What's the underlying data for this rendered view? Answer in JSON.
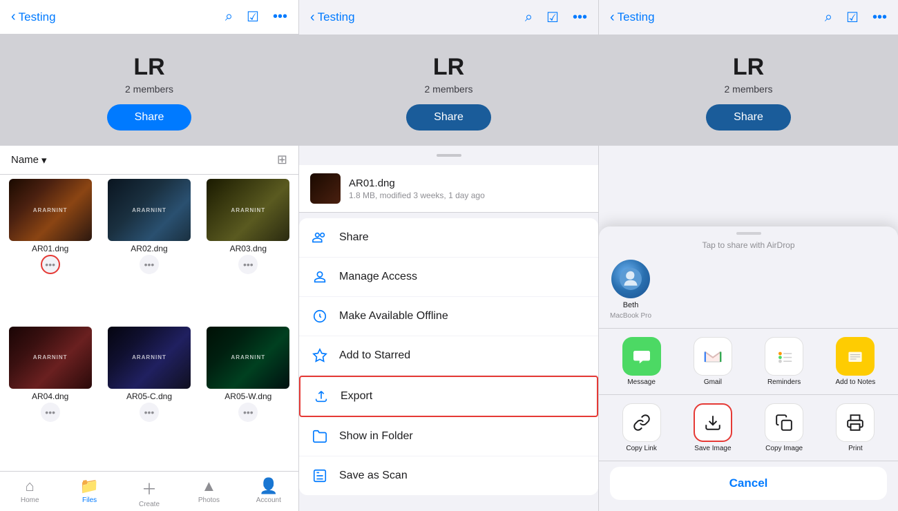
{
  "panel1": {
    "nav": {
      "back_label": "Testing",
      "search_icon": "search",
      "check_icon": "check",
      "more_icon": "more"
    },
    "header": {
      "title": "LR",
      "members": "2 members",
      "share_btn": "Share"
    },
    "sort": {
      "label": "Name",
      "chevron": "▾"
    },
    "files": [
      {
        "name": "AR01.dng",
        "thumb": "thumb-1",
        "show_more": true,
        "highlighted": true
      },
      {
        "name": "AR02.dng",
        "thumb": "thumb-2",
        "show_more": true,
        "highlighted": false
      },
      {
        "name": "AR03.dng",
        "thumb": "thumb-3",
        "show_more": true,
        "highlighted": false
      },
      {
        "name": "AR04.dng",
        "thumb": "thumb-4",
        "show_more": true,
        "highlighted": false
      },
      {
        "name": "AR05-C.dng",
        "thumb": "thumb-5",
        "show_more": true,
        "highlighted": false
      },
      {
        "name": "AR05-W.dng",
        "thumb": "thumb-6",
        "show_more": true,
        "highlighted": false
      }
    ],
    "tabs": [
      {
        "icon": "🏠",
        "label": "Home",
        "active": false
      },
      {
        "icon": "📁",
        "label": "Files",
        "active": true
      },
      {
        "icon": "➕",
        "label": "Create",
        "active": false
      },
      {
        "icon": "🖼️",
        "label": "Photos",
        "active": false
      },
      {
        "icon": "👤",
        "label": "Account",
        "active": false
      }
    ]
  },
  "panel2": {
    "nav": {
      "back_label": "Testing"
    },
    "header": {
      "title": "LR",
      "members": "2 members",
      "share_btn": "Share"
    },
    "file_info": {
      "name": "AR01.dng",
      "meta": "1.8 MB, modified 3 weeks, 1 day ago"
    },
    "menu_items": [
      {
        "icon": "👥",
        "label": "Share",
        "highlighted": false
      },
      {
        "icon": "👤",
        "label": "Manage Access",
        "highlighted": false
      },
      {
        "icon": "⬇️",
        "label": "Make Available Offline",
        "highlighted": false
      },
      {
        "icon": "⭐",
        "label": "Add to Starred",
        "highlighted": false
      },
      {
        "icon": "📤",
        "label": "Export",
        "highlighted": true
      },
      {
        "icon": "📂",
        "label": "Show in Folder",
        "highlighted": false
      },
      {
        "icon": "📄",
        "label": "Save as Scan",
        "highlighted": false
      }
    ]
  },
  "panel3": {
    "nav": {
      "back_label": "Testing"
    },
    "header": {
      "title": "LR",
      "members": "2 members",
      "share_btn": "Share"
    },
    "share_sheet": {
      "airdrop_label": "Tap to share with AirDrop",
      "airdrop_contacts": [
        {
          "name": "Beth",
          "sub": "MacBook Pro"
        }
      ],
      "apps": [
        {
          "label": "Message",
          "type": "messages"
        },
        {
          "label": "Gmail",
          "type": "gmail"
        },
        {
          "label": "Reminders",
          "type": "reminders"
        },
        {
          "label": "Add to Notes",
          "type": "notes"
        }
      ],
      "actions": [
        {
          "label": "Copy Link",
          "icon": "🔗",
          "highlighted": false
        },
        {
          "label": "Save Image",
          "icon": "⬇️",
          "highlighted": true
        },
        {
          "label": "Copy Image",
          "icon": "📋",
          "highlighted": false
        },
        {
          "label": "Print",
          "icon": "🖨️",
          "highlighted": false
        }
      ],
      "cancel_label": "Cancel"
    }
  }
}
